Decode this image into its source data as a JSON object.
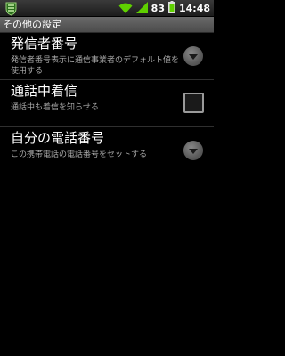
{
  "status_bar": {
    "battery": "83",
    "time": "14:48"
  },
  "title_bar": {
    "title": "その他の設定"
  },
  "settings": [
    {
      "title": "発信者番号",
      "summary": "発信者番号表示に通信事業者のデフォルト値を使用する",
      "control": "dropdown"
    },
    {
      "title": "通話中着信",
      "summary": "通話中も着信を知らせる",
      "control": "checkbox",
      "checked": false
    },
    {
      "title": "自分の電話番号",
      "summary": "この携帯電話の電話番号をセットする",
      "control": "dropdown"
    }
  ],
  "icons": {
    "notification": "app-notification-icon",
    "wifi": "wifi-icon",
    "signal": "signal-icon",
    "battery": "battery-icon",
    "dropdown": "chevron-down-icon"
  }
}
